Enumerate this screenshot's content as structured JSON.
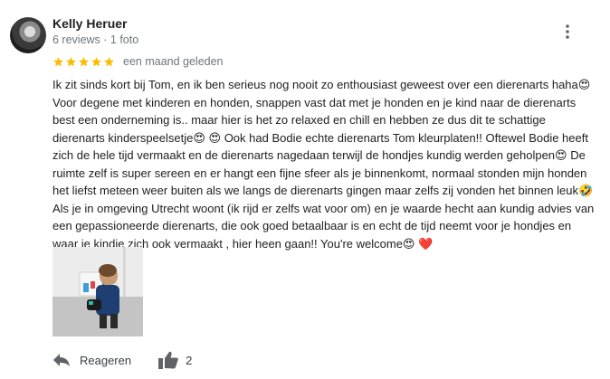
{
  "reviewer": {
    "name": "Kelly Heruer",
    "meta": "6 reviews · 1 foto"
  },
  "rating": {
    "stars": 5,
    "max": 5,
    "star_color": "#fbbc04"
  },
  "review": {
    "date": "een maand geleden",
    "text": "Ik zit sinds kort bij Tom, en ik ben serieus nog nooit zo enthousiast geweest over een dierenarts haha😍\nVoor degene met kinderen en honden, snappen vast dat met je honden en je kind naar de dierenarts\nbest een onderneming is.. maar hier is het zo relaxed en chill en hebben ze dus dit te schattige\ndierenarts kinderspeelsetje😍 😍  Ook had Bodie echte dierenarts Tom kleurplaten!! Oftewel Bodie heeft\nzich de hele tijd vermaakt en de dierenarts nagedaan terwijl de hondjes kundig werden geholpen😍 De\nruimte zelf is super sereen en er hangt een fijne sfeer als je binnenkomt, normaal stonden mijn honden\nhet liefst meteen weer buiten als we langs de dierenarts gingen maar zelfs zij vonden het binnen leuk🤣\nAls je in omgeving Utrecht woont (ik rijd er zelfs wat voor om) en je waarde hecht aan kundig advies van\neen gepassioneerde dierenarts, die ook goed betaalbaar is en echt de tijd neemt voor je hondjes en\nwaar je kindje zich ook vermaakt , hier heen gaan!! You're welcome😍 ❤️"
  },
  "actions": {
    "reply_label": "Reageren",
    "like_count": "2"
  },
  "icons": {
    "more": "more-vert-icon",
    "reply": "reply-arrow-icon",
    "like": "thumb-up-icon",
    "star": "star-icon"
  }
}
